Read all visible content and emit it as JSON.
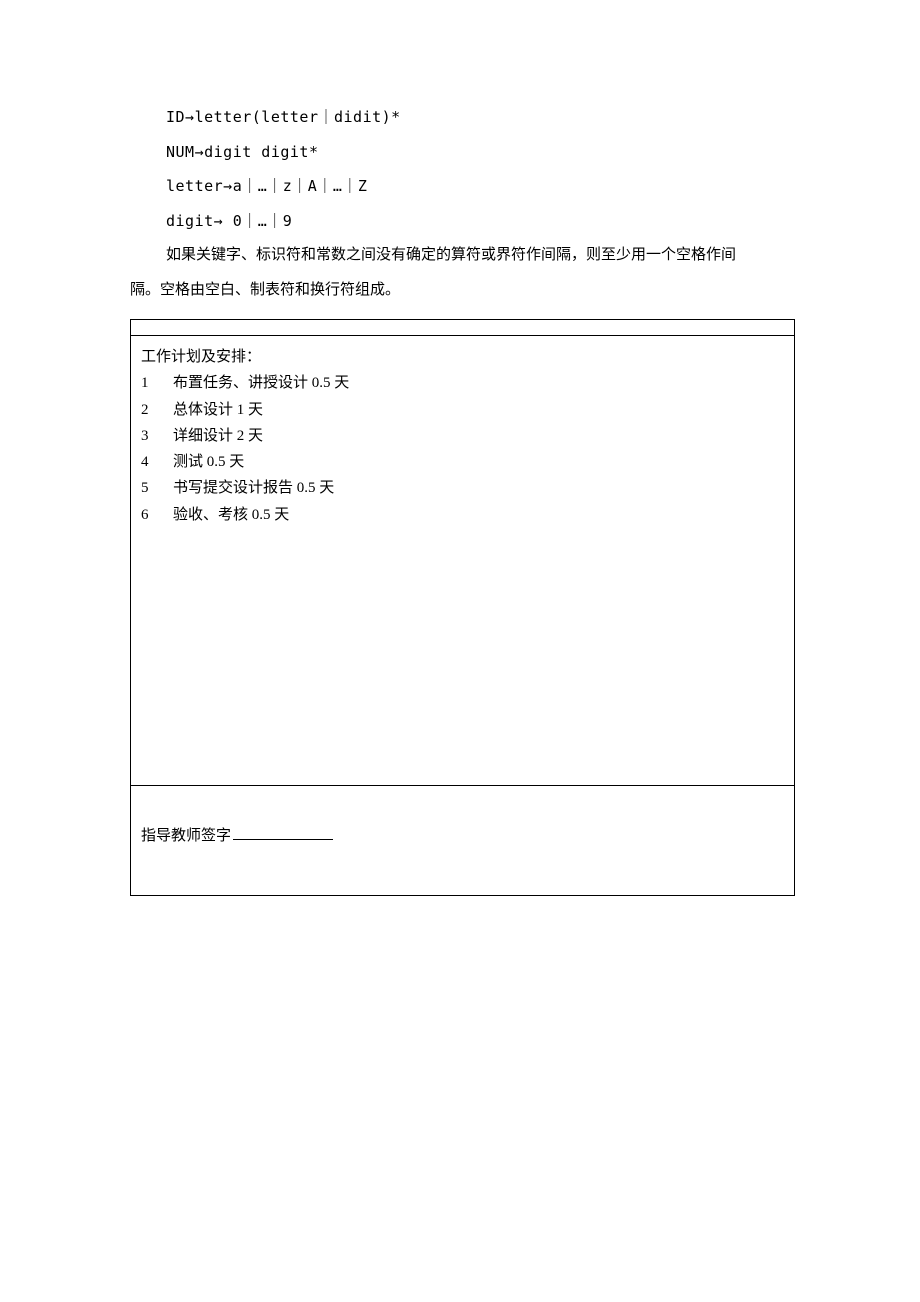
{
  "grammar": {
    "line1": "ID→letter(letter｜didit)*",
    "line2": "NUM→digit digit*",
    "line3": "letter→a｜…｜z｜A｜…｜Z",
    "line4": "digit→ 0｜…｜9"
  },
  "description": {
    "part1": "如果关键字、标识符和常数之间没有确定的算符或界符作间隔，则至少用一个空格作间",
    "part2": "隔。空格由空白、制表符和换行符组成。"
  },
  "plan": {
    "title": "工作计划及安排：",
    "items": [
      {
        "num": "1",
        "text": "布置任务、讲授设计   0.5 天"
      },
      {
        "num": "2",
        "text": "总体设计       1 天"
      },
      {
        "num": "3",
        "text": "详细设计       2 天"
      },
      {
        "num": "4",
        "text": "测试       0.5 天"
      },
      {
        "num": "5",
        "text": "书写提交设计报告       0.5 天"
      },
      {
        "num": "6",
        "text": "验收、考核   0.5 天"
      }
    ]
  },
  "signature": {
    "label": "指导教师签字"
  }
}
